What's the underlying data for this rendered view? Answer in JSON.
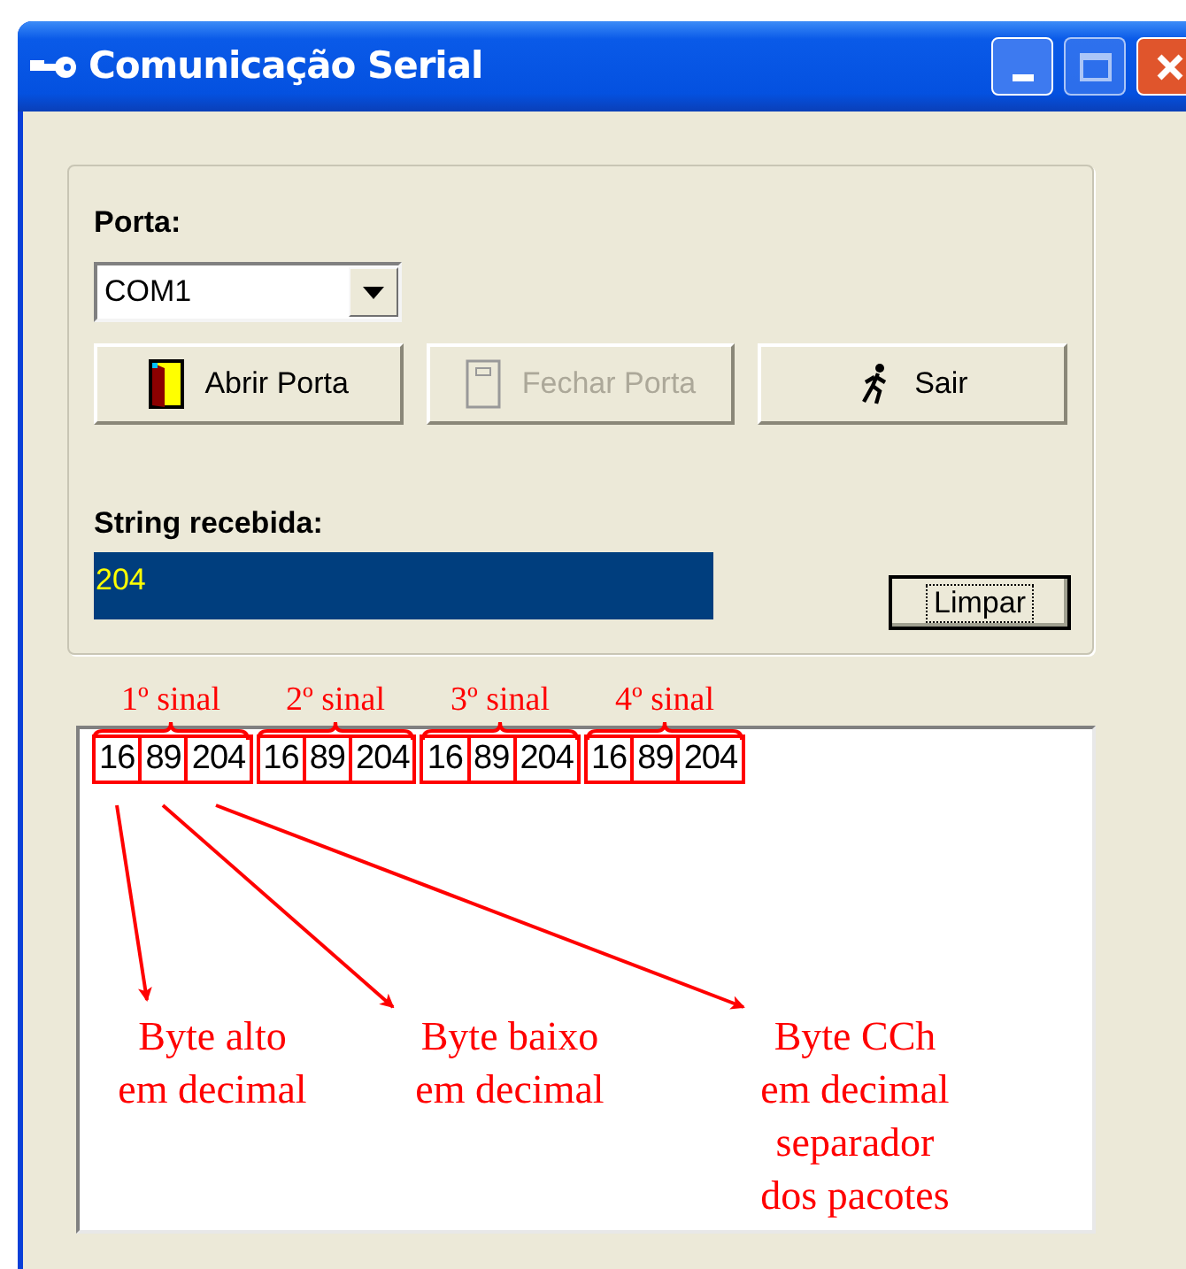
{
  "window": {
    "title": "Comunicação Serial"
  },
  "port": {
    "label": "Porta:",
    "value": "COM1"
  },
  "buttons": [
    {
      "label": "Abrir Porta",
      "kind": "open",
      "disabled": false
    },
    {
      "label": "Fechar Porta",
      "kind": "close",
      "disabled": true
    },
    {
      "label": "Sair",
      "kind": "exit",
      "disabled": false
    }
  ],
  "received": {
    "label": "String recebida:",
    "value": "204"
  },
  "clear_button": {
    "label": "Limpar"
  },
  "packets": [
    {
      "label": "1º sinal",
      "bytes": [
        "16",
        "89",
        "204"
      ]
    },
    {
      "label": "2º sinal",
      "bytes": [
        "16",
        "89",
        "204"
      ]
    },
    {
      "label": "3º sinal",
      "bytes": [
        "16",
        "89",
        "204"
      ]
    },
    {
      "label": "4º sinal",
      "bytes": [
        "16",
        "89",
        "204"
      ]
    }
  ],
  "notes": [
    "Byte alto\nem decimal",
    "Byte baixo\nem decimal",
    "Byte CCh\nem decimal\nseparador\ndos pacotes"
  ]
}
